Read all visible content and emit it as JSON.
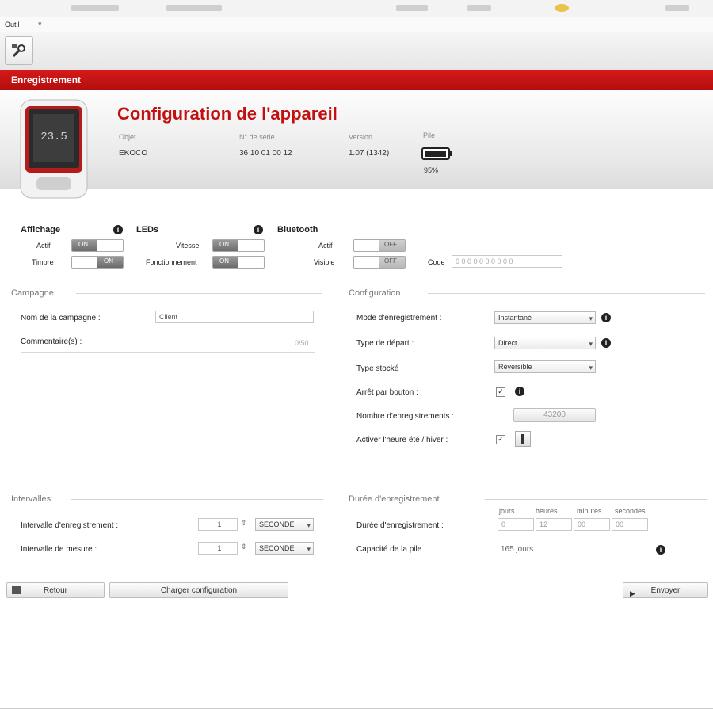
{
  "window": {
    "menu_label": "Outil"
  },
  "ribbon": {
    "section_label": "Enregistrement"
  },
  "device": {
    "title": "Configuration de l'appareil",
    "model_label": "Objet",
    "model_value": "EKOCO",
    "serial_label": "N° de série",
    "serial_value": "36 10 01 00 12",
    "version_label": "Version",
    "version_value": "1.07 (1342)",
    "battery_label": "Pile",
    "battery_value": "95%",
    "battery_level": 0.95
  },
  "affichage": {
    "title": "Affichage",
    "row1_label": "Actif",
    "row1_state": "ON",
    "row2_label": "Timbre",
    "row2_state": "ON"
  },
  "leds": {
    "title": "LEDs",
    "row1_label": "Vitesse",
    "row1_state": "ON",
    "row2_label": "Fonctionnement",
    "row2_state": "ON"
  },
  "bluetooth": {
    "title": "Bluetooth",
    "row1_label": "Actif",
    "row1_state": "OFF",
    "row2_label": "Visible",
    "row2_state": "OFF",
    "code_label": "Code",
    "code_value": "0 0 0 0 0 0 0 0 0 0"
  },
  "campaign": {
    "section_title": "Campagne",
    "name_label": "Nom de la campagne :",
    "name_value": "Client",
    "comments_label": "Commentaire(s) :",
    "comments_count": "0/50"
  },
  "config": {
    "section_title": "Configuration",
    "mode_label": "Mode d'enregistrement :",
    "mode_value": "Instantané",
    "start_label": "Type de départ :",
    "start_value": "Direct",
    "store_label": "Type stocké :",
    "store_value": "Réversible",
    "stop_label": "Arrêt par bouton :",
    "stop_checked": "✓",
    "count_label": "Nombre d'enregistrements :",
    "count_value": "43200",
    "time_label": "Activer l'heure été / hiver :",
    "time_checked": "✓"
  },
  "intervals": {
    "section_title": "Intervalles",
    "rec_label": "Intervalle d'enregistrement :",
    "rec_value": "1",
    "rec_unit": "SECONDE",
    "meas_label": "Intervalle de mesure :",
    "meas_value": "1",
    "meas_unit": "SECONDE"
  },
  "duration": {
    "section_title": "Durée d'enregistrement",
    "col_days": "jours",
    "col_hours": "heures",
    "col_minutes": "minutes",
    "col_seconds": "secondes",
    "label": "Durée d'enregistrement :",
    "days": "0",
    "hours": "12",
    "minutes": "00",
    "seconds": "00",
    "battery_label": "Capacité de la pile :",
    "battery_value": "165 jours"
  },
  "footer": {
    "back_label": "Retour",
    "save_label": "Charger configuration",
    "send_label": "Envoyer"
  }
}
